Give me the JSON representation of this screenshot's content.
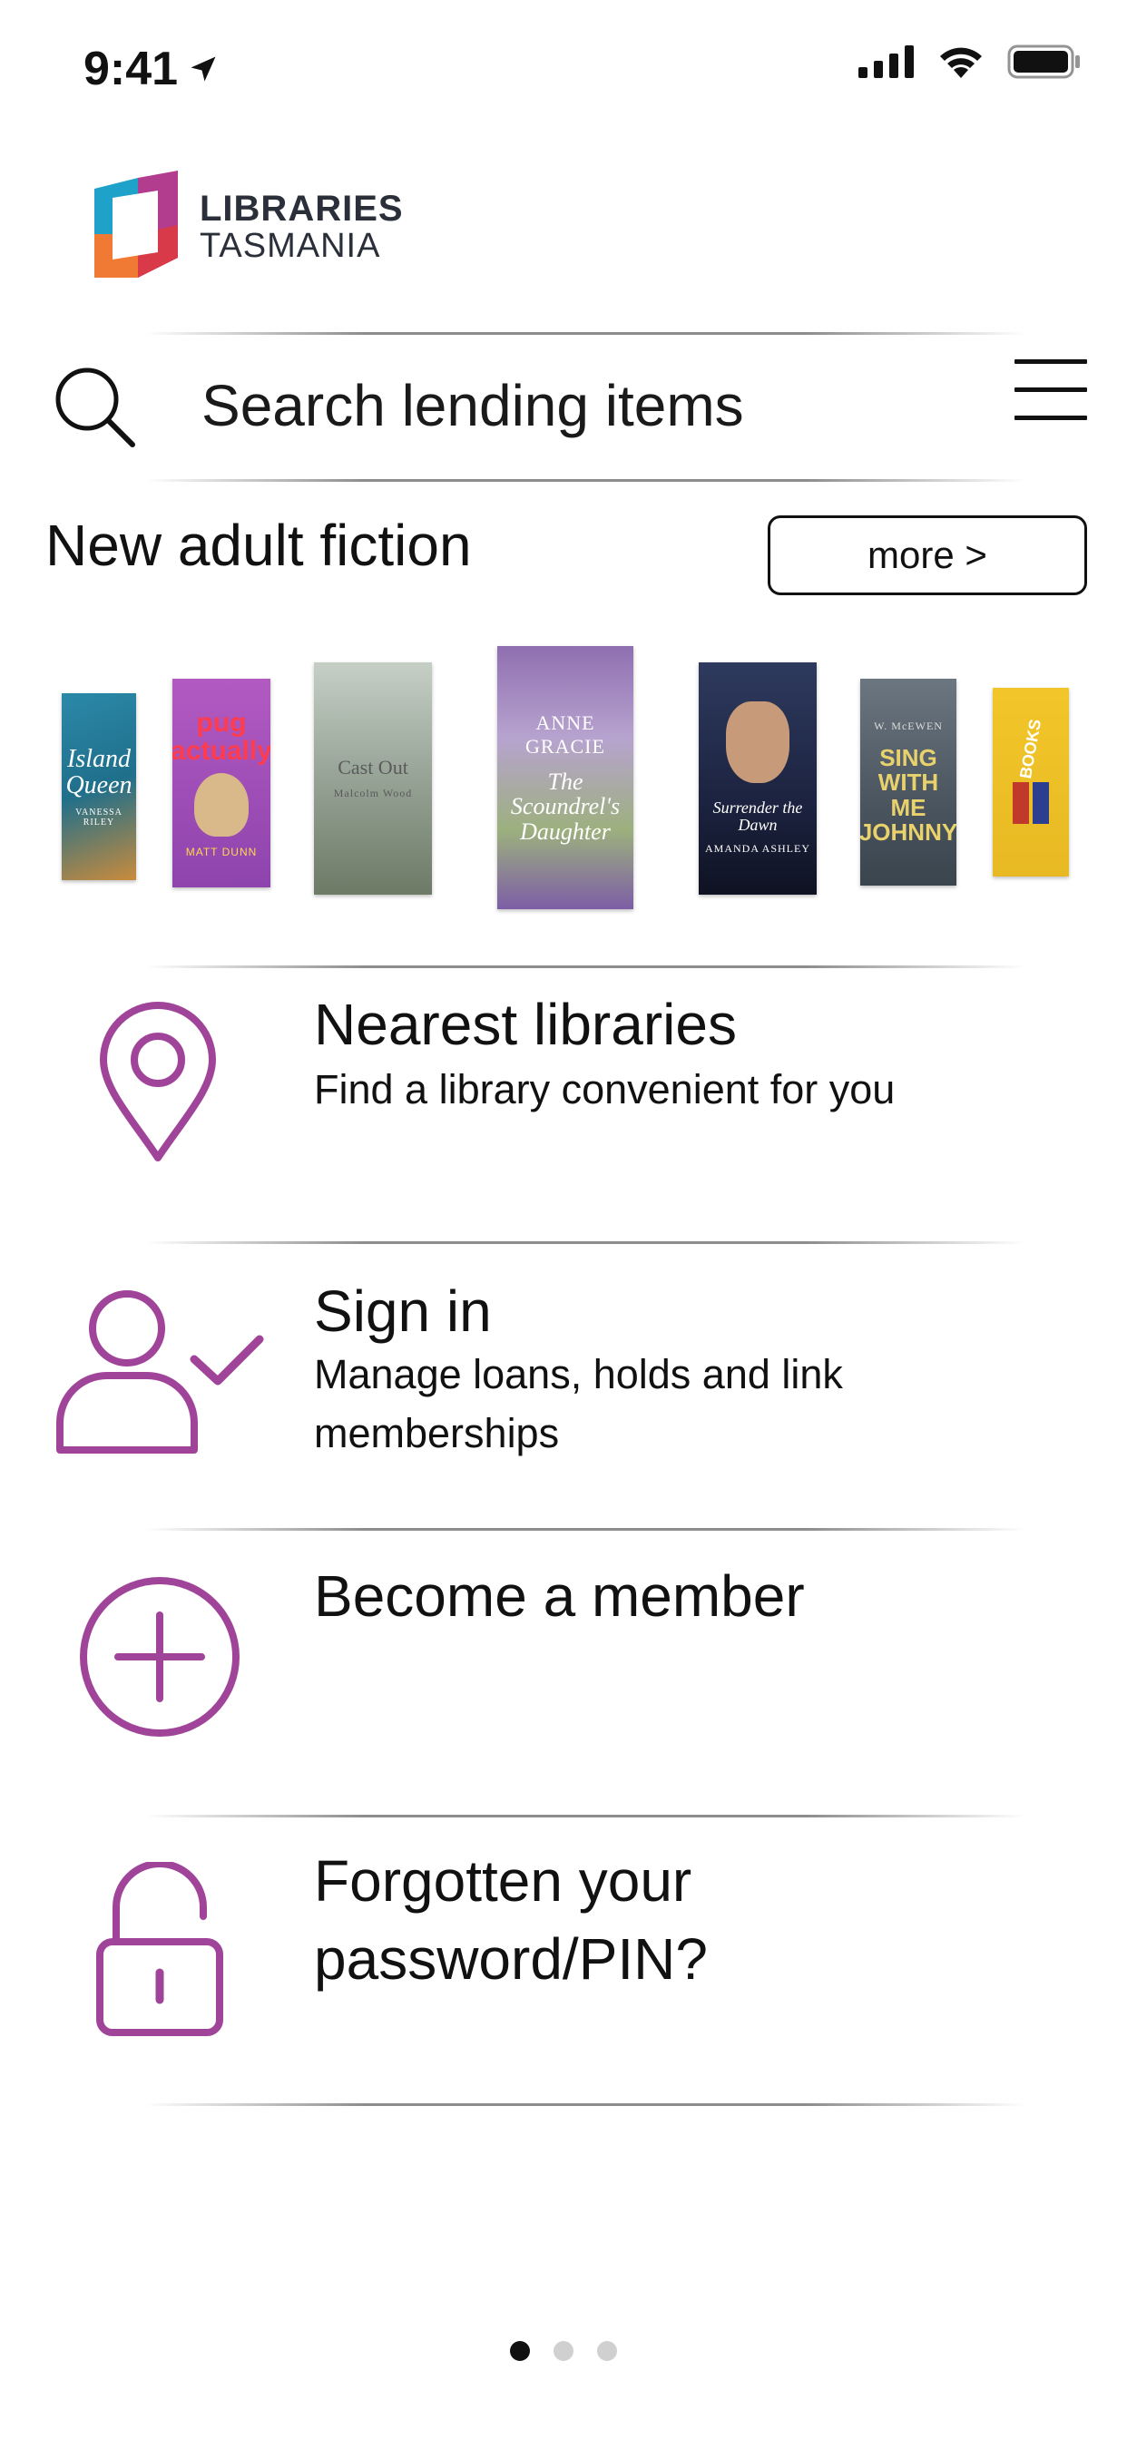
{
  "status_bar": {
    "time": "9:41"
  },
  "header": {
    "logo_line1": "LIBRARIES",
    "logo_line2": "TASMANIA"
  },
  "search": {
    "placeholder": "Search lending items"
  },
  "section": {
    "title": "New adult fiction",
    "more_label": "more >"
  },
  "books": [
    {
      "title": "Island Queen",
      "author": "VANESSA RILEY",
      "color": "#1f6f8b"
    },
    {
      "title": "pug actually",
      "author": "MATT DUNN",
      "color": "#8e44ad"
    },
    {
      "title": "Cast Out",
      "author": "Malcolm Wood",
      "color": "#8a9a8a"
    },
    {
      "title": "The Scoundrel's Daughter",
      "author": "ANNE GRACIE",
      "color": "#9b7fb6"
    },
    {
      "title": "Surrender the Dawn",
      "author": "AMANDA ASHLEY",
      "color": "#1c2340"
    },
    {
      "title": "SING WITH ME JOHNNY",
      "author": "W. McEWEN",
      "color": "#4a5560"
    },
    {
      "title": "BOOKS",
      "author": "",
      "color": "#e8b923"
    }
  ],
  "menu": {
    "nearest": {
      "title": "Nearest libraries",
      "subtitle": "Find a library convenient for you"
    },
    "signin": {
      "title": "Sign in",
      "subtitle": "Manage loans, holds and link memberships"
    },
    "member": {
      "title": "Become a member"
    },
    "forgot": {
      "title": "Forgotten your password/PIN?"
    }
  },
  "pagination": {
    "pages": 3,
    "active": 1
  },
  "colors": {
    "accent": "#a0449a",
    "text": "#111111"
  },
  "icons": {
    "search": "search-icon",
    "menu": "hamburger-menu-icon",
    "nearest": "location-pin-icon",
    "signin": "user-check-icon",
    "member": "plus-circle-icon",
    "forgot": "unlock-icon"
  }
}
